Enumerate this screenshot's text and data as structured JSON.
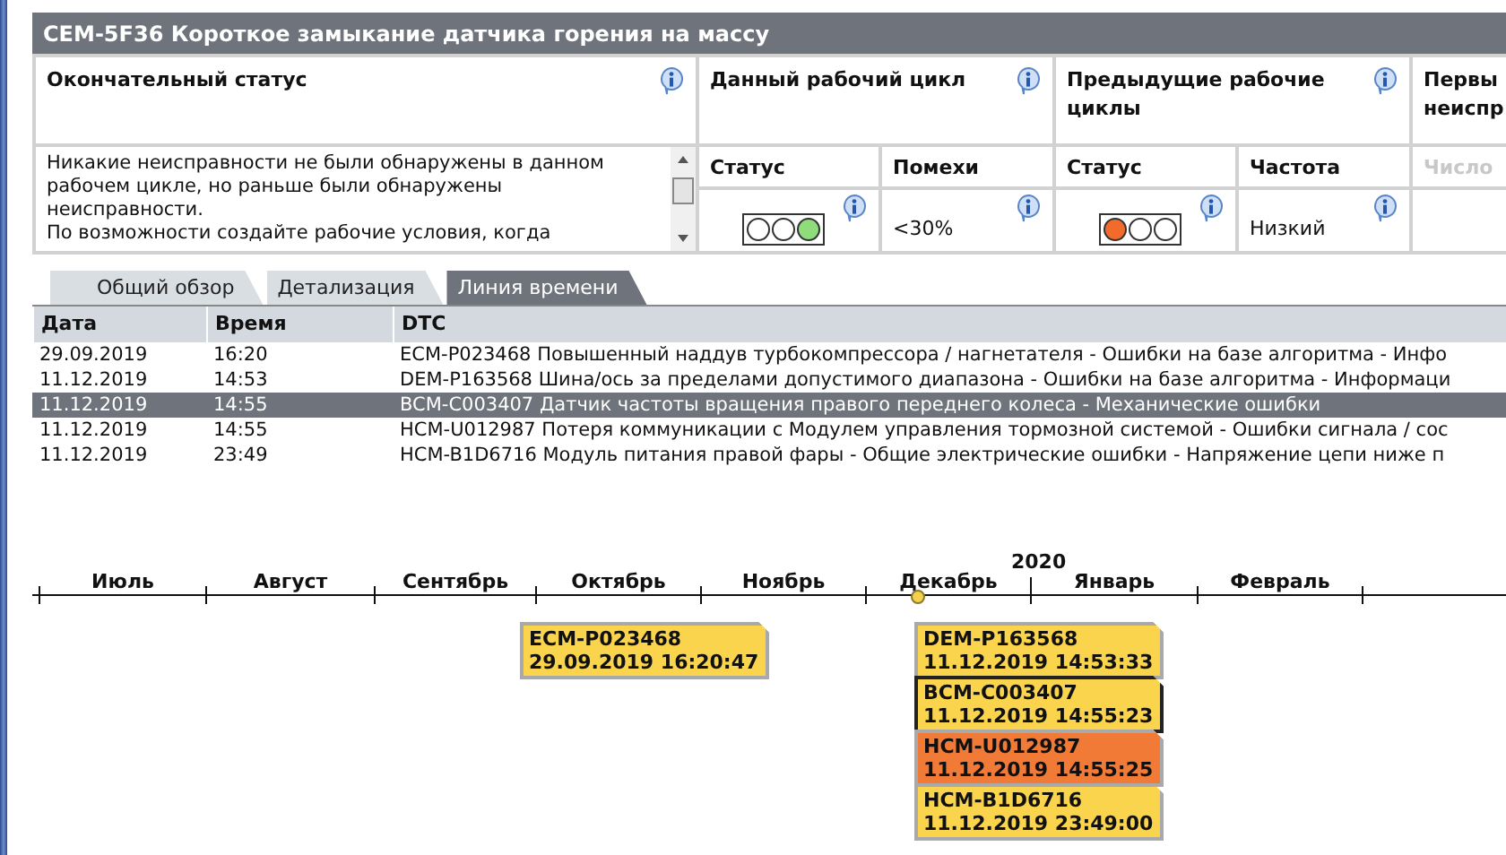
{
  "header": {
    "title": "CEM-5F36 Короткое замыкание датчика горения на массу"
  },
  "final_status": {
    "heading": "Окончательный статус",
    "paragraphs": [
      "Никакие неисправности не были обнаружены в данном рабочем цикле, но раньше были обнаружены неисправности.",
      "По возможности создайте рабочие условия, когда"
    ]
  },
  "current_cycle": {
    "heading": "Данный рабочий цикл",
    "status_label": "Статус",
    "lamps": [
      {
        "color": "#ffffff"
      },
      {
        "color": "#ffffff"
      },
      {
        "color": "#8fdc7c"
      }
    ],
    "second_label": "Помехи",
    "second_value": "<30%"
  },
  "previous_cycles": {
    "heading": "Предыдущие рабочие циклы",
    "status_label": "Статус",
    "lamps": [
      {
        "color": "#f26b2a"
      },
      {
        "color": "#ffffff"
      },
      {
        "color": "#ffffff"
      }
    ],
    "second_label": "Частота",
    "second_value": "Низкий"
  },
  "column_4": {
    "heading": "Первы неиспр",
    "sub_label": "Число",
    "disabled": true
  },
  "tabs": [
    {
      "label": "Общий обзор",
      "selected": false
    },
    {
      "label": "Детализация",
      "selected": false
    },
    {
      "label": "Линия времени",
      "selected": true
    }
  ],
  "table": {
    "columns": [
      "Дата",
      "Время",
      "DTC"
    ],
    "rows": [
      {
        "date": "29.09.2019",
        "time": "16:20",
        "dtc": "ECM-P023468 Повышенный наддув турбокомпрессора / нагнетателя - Ошибки на базе алгоритма - Инфо",
        "selected": false
      },
      {
        "date": "11.12.2019",
        "time": "14:53",
        "dtc": "DEM-P163568 Шина/ось за пределами допустимого диапазона - Ошибки на базе алгоритма - Информаци",
        "selected": false
      },
      {
        "date": "11.12.2019",
        "time": "14:55",
        "dtc": "BCM-C003407 Датчик частоты вращения правого переднего колеса - Механические ошибки",
        "selected": true
      },
      {
        "date": "11.12.2019",
        "time": "14:55",
        "dtc": "HCM-U012987 Потеря коммуникации с Модулем управления тормозной системой - Ошибки сигнала / сос",
        "selected": false
      },
      {
        "date": "11.12.2019",
        "time": "23:49",
        "dtc": "HCM-B1D6716 Модуль питания правой фары - Общие электрические ошибки - Напряжение цепи ниже п",
        "selected": false
      }
    ]
  },
  "timeline": {
    "year": "2020",
    "months": [
      "Июль",
      "Август",
      "Сентябрь",
      "Октябрь",
      "Ноябрь",
      "Декабрь",
      "Январь",
      "Февраль"
    ],
    "events": [
      {
        "code": "ECM-P023468",
        "timestamp": "29.09.2019 16:20:47",
        "color": "#f9d44c",
        "selected": false
      },
      {
        "code": "DEM-P163568",
        "timestamp": "11.12.2019 14:53:33",
        "color": "#f9d44c",
        "selected": false
      },
      {
        "code": "BCM-C003407",
        "timestamp": "11.12.2019 14:55:23",
        "color": "#f9d44c",
        "selected": true
      },
      {
        "code": "HCM-U012987",
        "timestamp": "11.12.2019 14:55:25",
        "color": "#f07a36",
        "selected": false
      },
      {
        "code": "HCM-B1D6716",
        "timestamp": "11.12.2019 23:49:00",
        "color": "#f9d44c",
        "selected": false
      }
    ]
  }
}
